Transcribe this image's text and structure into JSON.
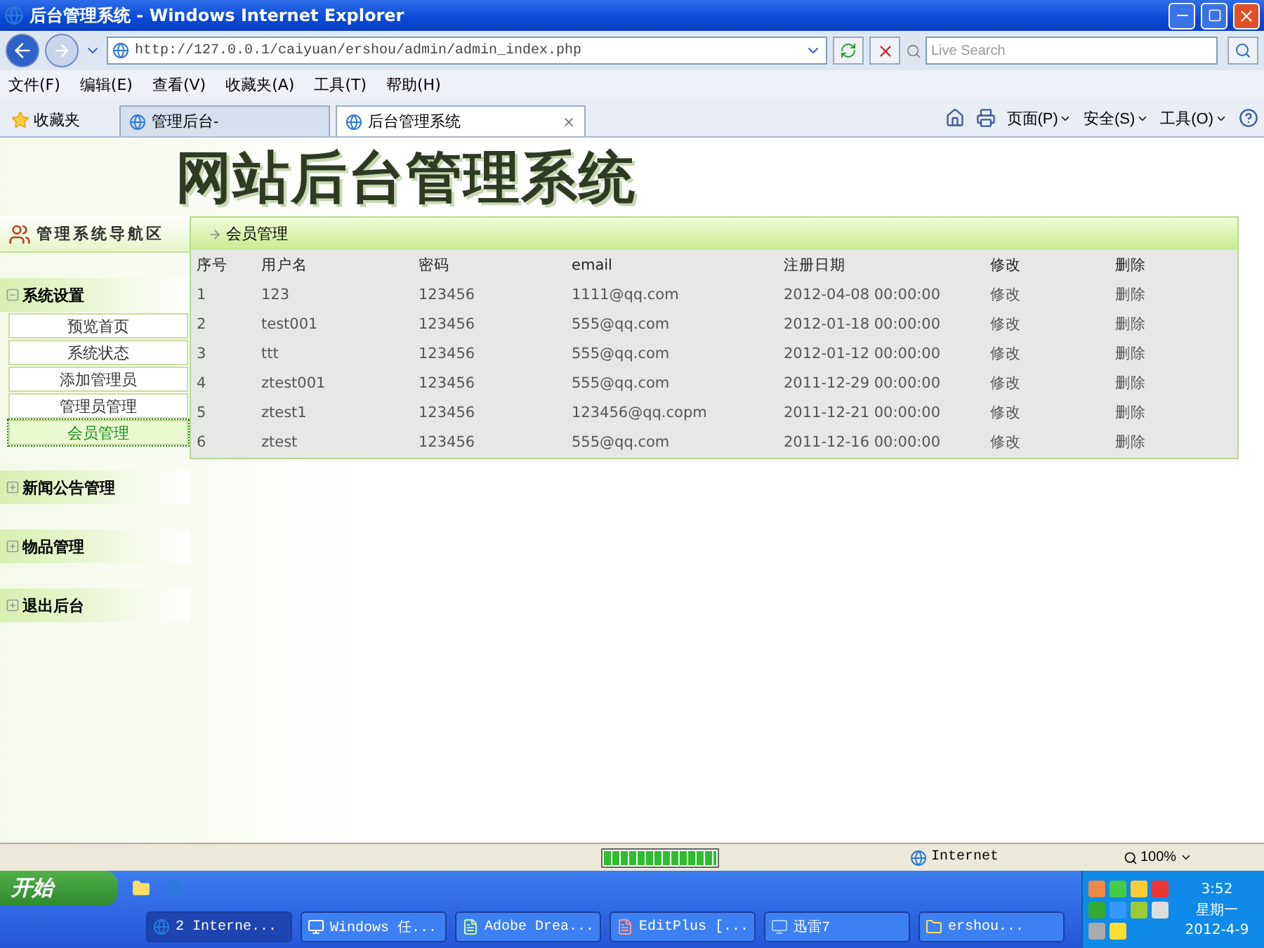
{
  "window": {
    "title": "后台管理系统 - Windows Internet Explorer"
  },
  "address_bar": {
    "url": "http://127.0.0.1/caiyuan/ershou/admin/admin_index.php"
  },
  "search": {
    "placeholder": "Live Search"
  },
  "menu": [
    "文件(F)",
    "编辑(E)",
    "查看(V)",
    "收藏夹(A)",
    "工具(T)",
    "帮助(H)"
  ],
  "favorites": {
    "label": "收藏夹"
  },
  "tabs": [
    {
      "label": "管理后台-",
      "selected": false
    },
    {
      "label": "后台管理系统",
      "selected": true
    }
  ],
  "command_bar": [
    "页面(P)",
    "安全(S)",
    "工具(O)"
  ],
  "page": {
    "heading": "网站后台管理系统",
    "nav": {
      "title": "管理系统导航区",
      "sections": [
        {
          "label": "系统设置",
          "expanded": true,
          "children": [
            {
              "label": "预览首页",
              "selected": false
            },
            {
              "label": "系统状态",
              "selected": false
            },
            {
              "label": "添加管理员",
              "selected": false
            },
            {
              "label": "管理员管理",
              "selected": false
            },
            {
              "label": "会员管理",
              "selected": true
            }
          ]
        },
        {
          "label": "新闻公告管理",
          "expanded": false
        },
        {
          "label": "物品管理",
          "expanded": false
        },
        {
          "label": "退出后台",
          "expanded": false
        }
      ]
    },
    "panel": {
      "title": "会员管理",
      "columns": [
        "序号",
        "用户名",
        "密码",
        "email",
        "注册日期",
        "修改",
        "删除"
      ],
      "rows": [
        [
          "1",
          "123",
          "123456",
          "1111@qq.com",
          "2012-04-08 00:00:00",
          "修改",
          "删除"
        ],
        [
          "2",
          "test001",
          "123456",
          "555@qq.com",
          "2012-01-18 00:00:00",
          "修改",
          "删除"
        ],
        [
          "3",
          "ttt",
          "123456",
          "555@qq.com",
          "2012-01-12 00:00:00",
          "修改",
          "删除"
        ],
        [
          "4",
          "ztest001",
          "123456",
          "555@qq.com",
          "2011-12-29 00:00:00",
          "修改",
          "删除"
        ],
        [
          "5",
          "ztest1",
          "123456",
          "123456@qq.copm",
          "2011-12-21 00:00:00",
          "修改",
          "删除"
        ],
        [
          "6",
          "ztest",
          "123456",
          "555@qq.com",
          "2011-12-16 00:00:00",
          "修改",
          "删除"
        ]
      ]
    }
  },
  "status_bar": {
    "progress": {
      "level": 1
    },
    "zone": "Internet",
    "zoom": "100%"
  },
  "taskbar": {
    "start": "开始",
    "tasks": [
      "2 Interne...",
      "Windows 任...",
      "Adobe Drea...",
      "EditPlus [...",
      "迅雷7",
      "ershou..."
    ],
    "clock": {
      "time": "3:52",
      "weekday": "星期一",
      "date": "2012-4-9"
    }
  }
}
